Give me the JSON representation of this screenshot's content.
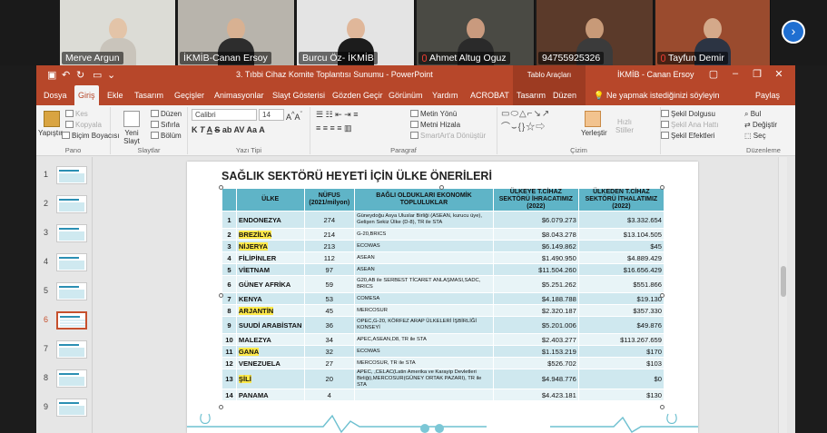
{
  "participants": [
    {
      "name": "Merve Argun",
      "bg": "#dcdcd6",
      "skin": "#e3c4a8",
      "cloth": "#c9c4bb",
      "muted": false
    },
    {
      "name": "İKMİB-Canan Ersoy",
      "bg": "#b8b4ac",
      "skin": "#d8b192",
      "cloth": "#2d2d2d",
      "muted": false
    },
    {
      "name": "Burcu Öz- İKMİB",
      "bg": "#e4e4e4",
      "skin": "#e0b79a",
      "cloth": "#1c1c1c",
      "muted": false
    },
    {
      "name": "Ahmet Altug Oguz",
      "bg": "#4a4a44",
      "skin": "#c99a7e",
      "cloth": "#2a2a2a",
      "muted": true
    },
    {
      "name": "94755925326",
      "bg": "#5b3a2a",
      "skin": "#c89a78",
      "cloth": "#3b3b3b",
      "muted": false
    },
    {
      "name": "Tayfun Demir",
      "bg": "#9a4b2e",
      "skin": "#d4a98a",
      "cloth": "#2c3443",
      "muted": true
    }
  ],
  "app": {
    "doc_title": "3. Tıbbi Cihaz Komite Toplantısı Sunumu  -  PowerPoint",
    "context_tab": "Tablo Araçları",
    "account": "İKMİB - Canan Ersoy",
    "tabs": [
      "Dosya",
      "Giriş",
      "Ekle",
      "Tasarım",
      "Geçişler",
      "Animasyonlar",
      "Slayt Gösterisi",
      "Gözden Geçir",
      "Görünüm",
      "Yardım",
      "ACROBAT",
      "Tasarım",
      "Düzen"
    ],
    "tell_me": "Ne yapmak istediğinizi söyleyin",
    "share": "Paylaş"
  },
  "ribbon": {
    "paste": "Yapıştır",
    "cut": "Kes",
    "copy": "Kopyala",
    "format_painter": "Biçim Boyacısı",
    "group_clipboard": "Pano",
    "new_slide": "Yeni Slayt",
    "layout": "Düzen",
    "reset": "Sıfırla",
    "section": "Bölüm",
    "group_slides": "Slaytlar",
    "font_name": "Calibri",
    "font_size": "14",
    "group_font": "Yazı Tipi",
    "text_direction": "Metin Yönü",
    "align_text": "Metni Hizala",
    "smartart": "SmartArt'a Dönüştür",
    "group_paragraph": "Paragraf",
    "arrange": "Yerleştir",
    "quick_styles": "Hızlı Stiller",
    "shape_fill": "Şekil Dolgusu",
    "shape_outline": "Şekil Ana Hattı",
    "shape_effects": "Şekil Efektleri",
    "group_drawing": "Çizim",
    "find": "Bul",
    "replace": "Değiştir",
    "select": "Seç",
    "group_editing": "Düzenleme"
  },
  "thumbnails": [
    "1",
    "2",
    "3",
    "4",
    "5",
    "6",
    "7",
    "8",
    "9"
  ],
  "active_slide": "6",
  "slide": {
    "title": "SAĞLIK SEKTÖRÜ HEYETİ İÇİN ÜLKE ÖNERİLERİ",
    "headers": [
      "ÜLKE",
      "NÜFUS (2021/milyon)",
      "BAĞLI OLDUKLARI EKONOMİK TOPLULUKLAR",
      "ÜLKEYE T.CİHAZ SEKTÖRÜ İHRACATIMIZ (2022)",
      "ÜLKEDEN T.CİHAZ SEKTÖRÜ İTHALATIMIZ (2022)"
    ],
    "rows": [
      {
        "no": "1",
        "ulke": "ENDONEZYA",
        "nufus": "274",
        "org": "Güneydoğu Asya Uluslar Birliği (ASEAN, kurucu üye), Gelişen Sekiz Ülke (D-8), TR ile STA",
        "ihr": "$6.079.273",
        "ith": "$3.332.654",
        "hl": false
      },
      {
        "no": "2",
        "ulke": "BREZİLYA",
        "nufus": "214",
        "org": "G-20,BRICS",
        "ihr": "$8.043.278",
        "ith": "$13.104.505",
        "hl": true
      },
      {
        "no": "3",
        "ulke": "NİJERYA",
        "nufus": "213",
        "org": "ECOWAS",
        "ihr": "$6.149.862",
        "ith": "$45",
        "hl": true
      },
      {
        "no": "4",
        "ulke": "FİLİPİNLER",
        "nufus": "112",
        "org": "ASEAN",
        "ihr": "$1.490.950",
        "ith": "$4.889.429",
        "hl": false
      },
      {
        "no": "5",
        "ulke": "VİETNAM",
        "nufus": "97",
        "org": "ASEAN",
        "ihr": "$11.504.260",
        "ith": "$16.656.429",
        "hl": false
      },
      {
        "no": "6",
        "ulke": "GÜNEY AFRİKA",
        "nufus": "59",
        "org": "G20,AB ile SERBEST TİCARET ANLAŞMASI,SADC, BRICS",
        "ihr": "$5.251.262",
        "ith": "$551.866",
        "hl": false
      },
      {
        "no": "7",
        "ulke": "KENYA",
        "nufus": "53",
        "org": "COMESA",
        "ihr": "$4.188.788",
        "ith": "$19.130",
        "hl": false
      },
      {
        "no": "8",
        "ulke": "ARJANTİN",
        "nufus": "45",
        "org": "MERCOSUR",
        "ihr": "$2.320.187",
        "ith": "$357.330",
        "hl": true
      },
      {
        "no": "9",
        "ulke": "SUUDİ ARABİSTAN",
        "nufus": "36",
        "org": "OPEC,G-20, KÖRFEZ ARAP ÜLKELERİ İŞBİRLİĞİ KONSEYİ",
        "ihr": "$5.201.006",
        "ith": "$49.876",
        "hl": false
      },
      {
        "no": "10",
        "ulke": "MALEZYA",
        "nufus": "34",
        "org": "APEC,ASEAN,D8, TR ile STA",
        "ihr": "$2.403.277",
        "ith": "$113.267.659",
        "hl": false
      },
      {
        "no": "11",
        "ulke": "GANA",
        "nufus": "32",
        "org": "ECOWAS",
        "ihr": "$1.153.219",
        "ith": "$170",
        "hl": true
      },
      {
        "no": "12",
        "ulke": "VENEZUELA",
        "nufus": "27",
        "org": "MERCOSUR, TR ile STA",
        "ihr": "$526.702",
        "ith": "$103",
        "hl": false
      },
      {
        "no": "13",
        "ulke": "ŞİLİ",
        "nufus": "20",
        "org": "APEC, ,CELAC(Latin Amerika ve Karayip Devletleri Birliği),MERCOSUR(GÜNEY ORTAK PAZARI), TR ile STA",
        "ihr": "$4.948.776",
        "ith": "$0",
        "hl": true
      },
      {
        "no": "14",
        "ulke": "PANAMA",
        "nufus": "4",
        "org": "",
        "ihr": "$4.423.181",
        "ith": "$130",
        "hl": false
      }
    ]
  },
  "colors": {
    "accent": "#b7472a",
    "table_header": "#5fb4c7",
    "highlight": "#ffe94a"
  }
}
